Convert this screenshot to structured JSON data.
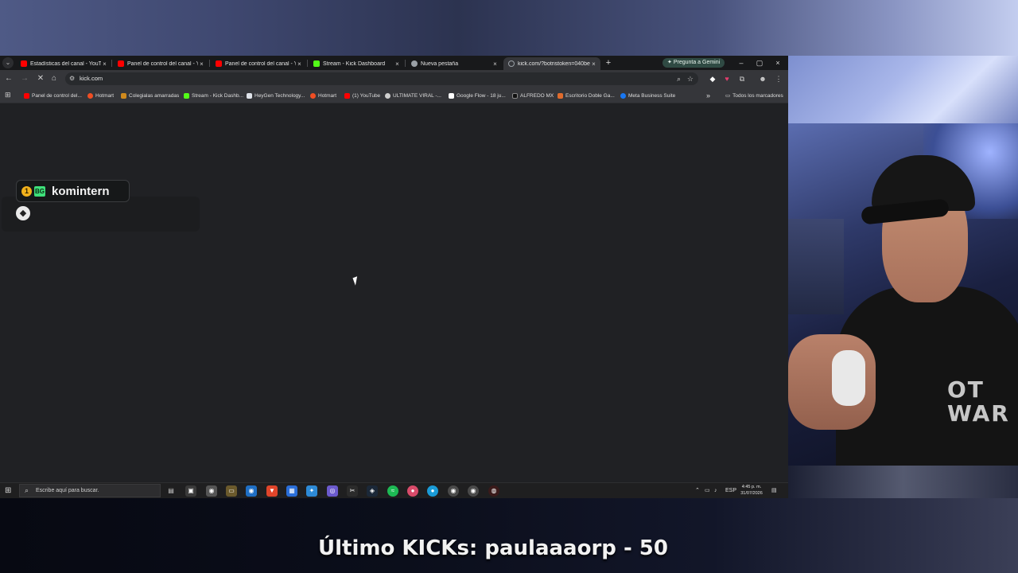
{
  "browser": {
    "tabs": [
      {
        "title": "Estadísticas del canal - YouTube",
        "favicon_color": "#ff0000",
        "active": false
      },
      {
        "title": "Panel de control del canal - You",
        "favicon_color": "#ff0000",
        "active": false
      },
      {
        "title": "Panel de control del canal - You",
        "favicon_color": "#ff0000",
        "active": false
      },
      {
        "title": "Stream - Kick Dashboard",
        "favicon_color": "#53fc18",
        "active": false
      },
      {
        "title": "Nueva pestaña",
        "favicon_color": "#9aa0a6",
        "active": false
      },
      {
        "title": "kick.com/?botristoken=040be",
        "favicon_color": "#9aa0a6",
        "active": true
      }
    ],
    "tab_close_icon": "×",
    "new_tab_icon": "+",
    "gemini_label": "Pregunta a Gemini",
    "window_controls": {
      "minimize": "–",
      "maximize": "▢",
      "close": "×"
    },
    "address": "kick.com",
    "bookmarks": [
      {
        "label": "Panel de control del...",
        "favicon_color": "#ff0000"
      },
      {
        "label": "Hotmart",
        "favicon_color": "#f04e23"
      },
      {
        "label": "Colegialas amarradas",
        "favicon_color": "#d08a1d"
      },
      {
        "label": "Stream - Kick Dashb...",
        "favicon_color": "#53fc18"
      },
      {
        "label": "HeyGen Technology...",
        "favicon_color": "#dfe3ea"
      },
      {
        "label": "Hotmart",
        "favicon_color": "#f04e23"
      },
      {
        "label": "(1) YouTube",
        "favicon_color": "#ff0000"
      },
      {
        "label": "ULTIMATE VIRAL -...",
        "favicon_color": "#cfcfcf"
      },
      {
        "label": "Google Flow - 18 ju...",
        "favicon_color": "#ffffff"
      },
      {
        "label": "ALFREDO MX",
        "favicon_color": "#111111"
      },
      {
        "label": "Escritorio Doble Ga...",
        "favicon_color": "#e06b2c"
      },
      {
        "label": "Meta Business Suite",
        "favicon_color": "#1877f2"
      }
    ],
    "bookmarks_overflow": "»",
    "all_bookmarks": "Todos los marcadores"
  },
  "page": {
    "badge_name": "komintern",
    "badge_coin": "1",
    "badge_logo": "BG"
  },
  "taskbar": {
    "search_placeholder": "Escribe aquí para buscar.",
    "language": "ESP",
    "time": "4:45 p. m.",
    "date": "31/07/2026"
  },
  "stream": {
    "overlay_text": "Último KICKs: paulaaaorp - 50",
    "webcam_shirt_text": "OT\nWAR"
  },
  "icons": {
    "back": "back-arrow-icon",
    "forward": "forward-arrow-icon",
    "reload": "stop-loading-icon",
    "home": "home-icon",
    "search": "search-icon",
    "star": "bookmark-star-icon"
  }
}
